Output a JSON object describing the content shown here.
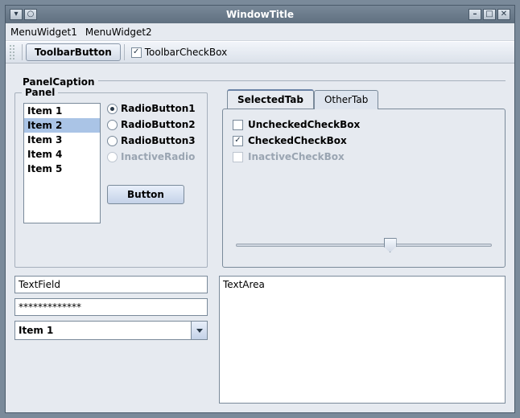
{
  "window": {
    "title": "WindowTitle"
  },
  "titlebar_buttons": {
    "left": [
      {
        "name": "menu-down-button",
        "glyph": "▾"
      },
      {
        "name": "menu-circle-button",
        "glyph": "○"
      }
    ],
    "right": [
      {
        "name": "minimize-button",
        "glyph": "–"
      },
      {
        "name": "maximize-button",
        "glyph": "□"
      },
      {
        "name": "close-button",
        "glyph": "✕"
      }
    ]
  },
  "menubar": {
    "items": [
      "MenuWidget1",
      "MenuWidget2"
    ]
  },
  "toolbar": {
    "button_label": "ToolbarButton",
    "checkbox_label": "ToolbarCheckBox",
    "checkbox_checked": true
  },
  "panelCaption": "PanelCaption",
  "panel": {
    "label": "Panel",
    "list_items": [
      "Item 1",
      "Item 2",
      "Item 3",
      "Item 4",
      "Item 5"
    ],
    "selected_index": 1,
    "radios": [
      {
        "label": "RadioButton1",
        "selected": true,
        "disabled": false
      },
      {
        "label": "RadioButton2",
        "selected": false,
        "disabled": false
      },
      {
        "label": "RadioButton3",
        "selected": false,
        "disabled": false
      },
      {
        "label": "InactiveRadio",
        "selected": false,
        "disabled": true
      }
    ],
    "button_label": "Button"
  },
  "tabs": {
    "labels": [
      "SelectedTab",
      "OtherTab"
    ],
    "selected_index": 0,
    "checkboxes": [
      {
        "label": "UncheckedCheckBox",
        "checked": false,
        "disabled": false
      },
      {
        "label": "CheckedCheckBox",
        "checked": true,
        "disabled": false
      },
      {
        "label": "InactiveCheckBox",
        "checked": false,
        "disabled": true
      }
    ],
    "slider_value": 60
  },
  "textfield": {
    "value": "TextField"
  },
  "password": {
    "value": "*************"
  },
  "combobox": {
    "selected": "Item 1"
  },
  "textarea": {
    "value": "TextArea"
  }
}
